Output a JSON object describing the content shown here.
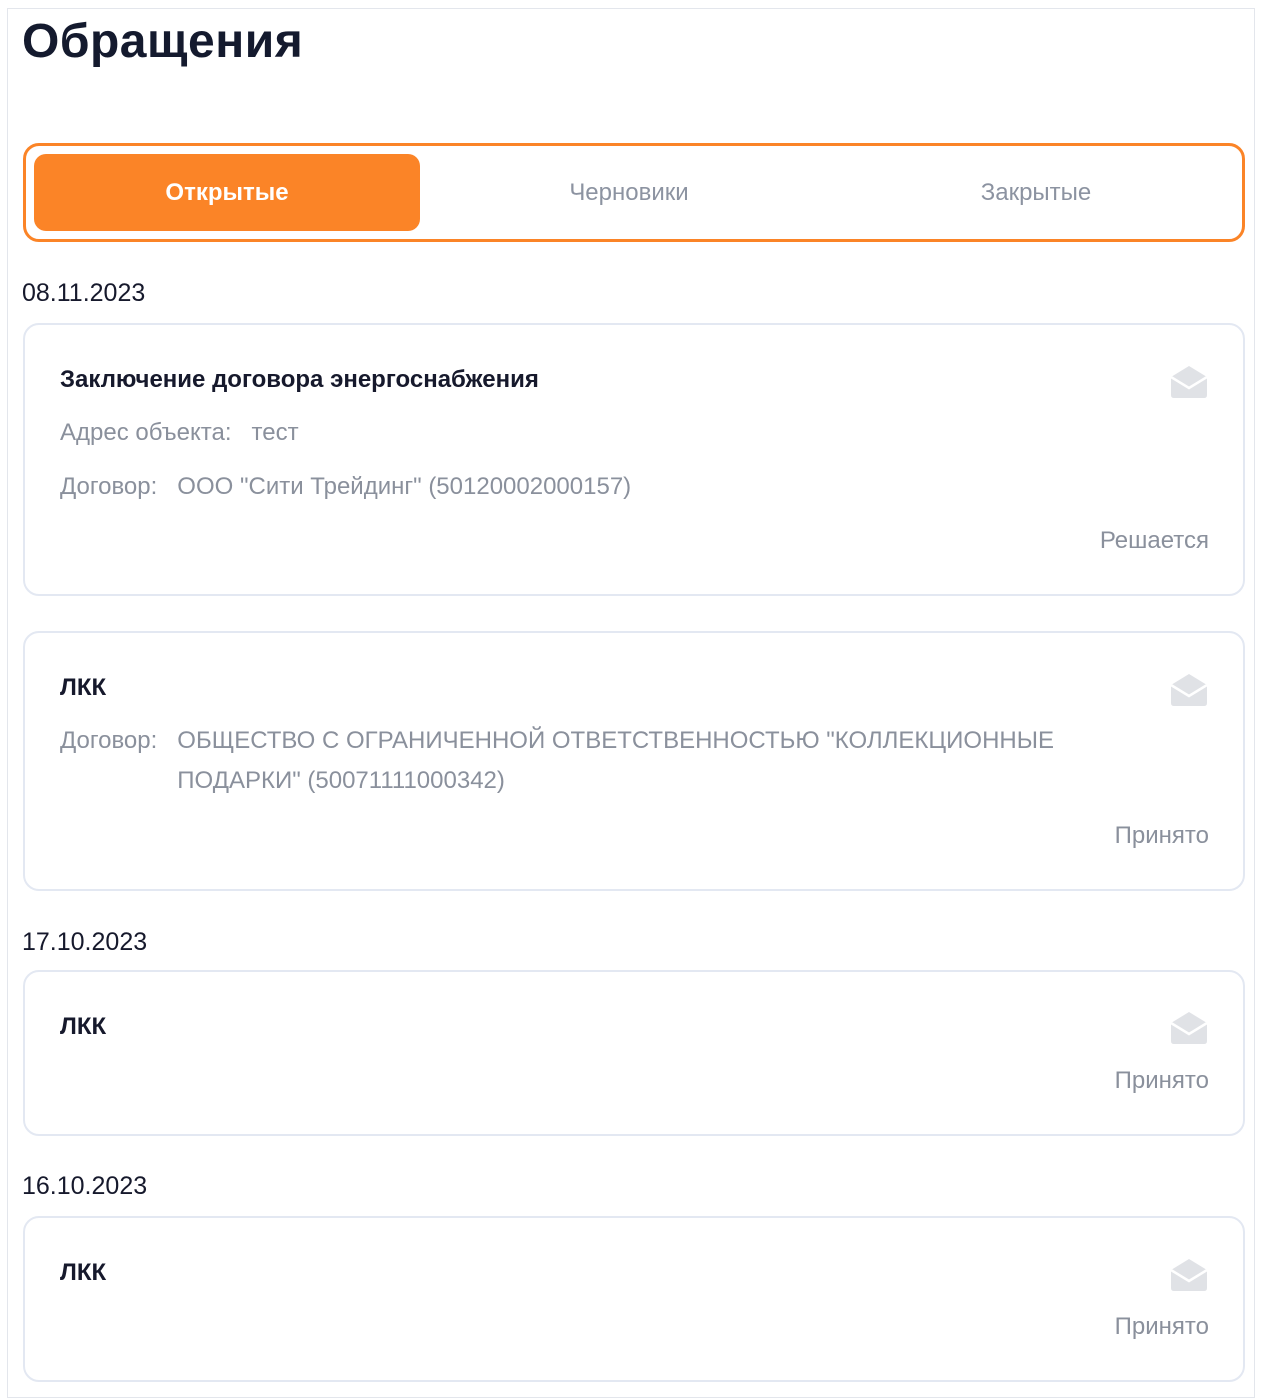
{
  "page": {
    "title": "Обращения"
  },
  "tabs": [
    {
      "label": "Открытые",
      "active": true
    },
    {
      "label": "Черновики",
      "active": false
    },
    {
      "label": "Закрытые",
      "active": false
    }
  ],
  "groups": [
    {
      "date": "08.11.2023",
      "requests": [
        {
          "title": "Заключение договора энергоснабжения",
          "address_label": "Адрес объекта:",
          "address_value": "тест",
          "contract_label": "Договор:",
          "contract_value": "ООО \"Сити Трейдинг\" (50120002000157)",
          "status": "Решается",
          "icon": "envelope-open-icon"
        },
        {
          "title": "ЛКК",
          "contract_label": "Договор:",
          "contract_value": "ОБЩЕСТВО С ОГРАНИЧЕННОЙ ОТВЕТСТВЕННОСТЬЮ \"КОЛЛЕКЦИОННЫЕ ПОДАРКИ\" (50071111000342)",
          "status": "Принято",
          "icon": "envelope-open-icon"
        }
      ]
    },
    {
      "date": "17.10.2023",
      "requests": [
        {
          "title": "ЛКК",
          "status": "Принято",
          "icon": "envelope-open-icon"
        }
      ]
    },
    {
      "date": "16.10.2023",
      "requests": [
        {
          "title": "ЛКК",
          "status": "Принято",
          "icon": "envelope-open-icon"
        }
      ]
    }
  ],
  "colors": {
    "accent": "#fb8427",
    "text_primary": "#16192c",
    "text_secondary": "#8a909c",
    "card_border": "#e3e8f2",
    "icon": "#e0e2e6"
  }
}
